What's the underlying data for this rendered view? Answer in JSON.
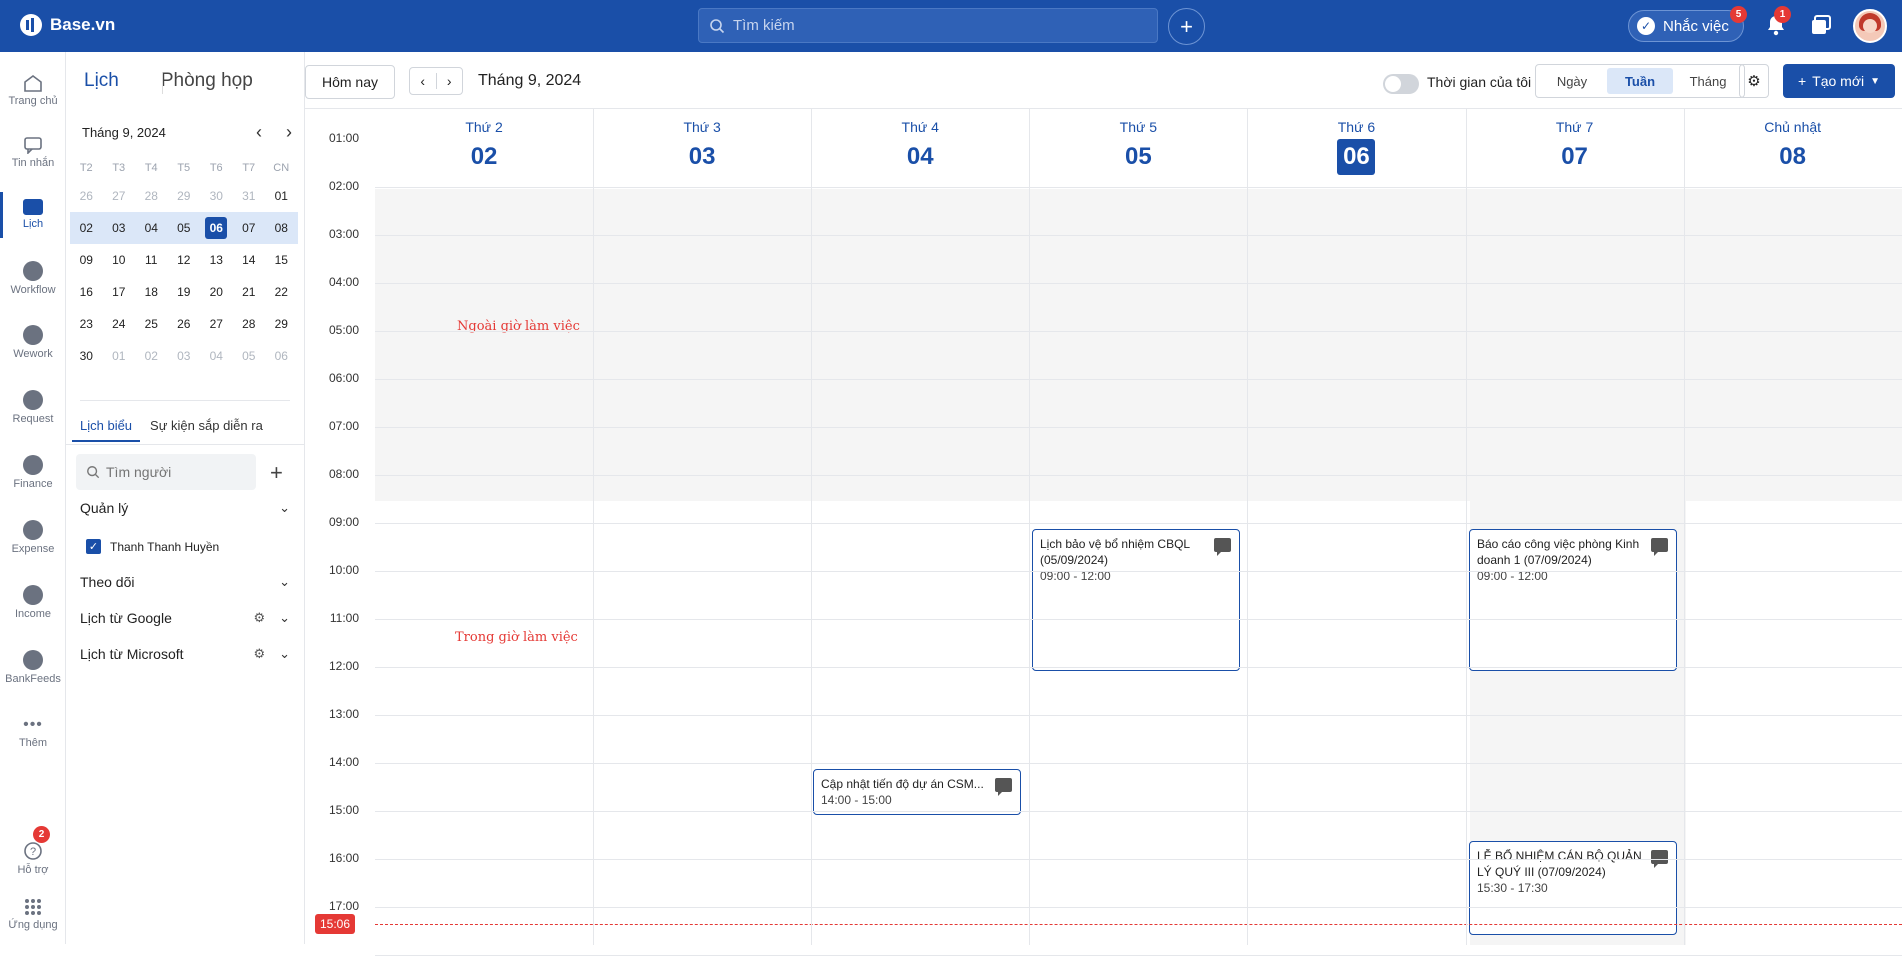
{
  "app": {
    "name": "Base.vn"
  },
  "topbar": {
    "search_placeholder": "Tìm kiếm",
    "remind_label": "Nhắc việc",
    "remind_badge": "5",
    "notif_badge": "1"
  },
  "nav": {
    "items": [
      {
        "label": "Trang chủ"
      },
      {
        "label": "Tin nhắn"
      },
      {
        "label": "Lịch"
      },
      {
        "label": "Workflow"
      },
      {
        "label": "Wework"
      },
      {
        "label": "Request"
      },
      {
        "label": "Finance"
      },
      {
        "label": "Expense"
      },
      {
        "label": "Income"
      },
      {
        "label": "BankFeeds"
      },
      {
        "label": "Thêm"
      }
    ],
    "support_label": "Hỗ trợ",
    "support_badge": "2",
    "apps_label": "Ứng dụng"
  },
  "sidebar": {
    "tab_calendar": "Lịch",
    "tab_rooms": "Phòng họp",
    "mini_title": "Tháng 9, 2024",
    "weekdays": [
      "T2",
      "T3",
      "T4",
      "T5",
      "T6",
      "T7",
      "CN"
    ],
    "weeks": [
      [
        "26",
        "27",
        "28",
        "29",
        "30",
        "31",
        "01"
      ],
      [
        "02",
        "03",
        "04",
        "05",
        "06",
        "07",
        "08"
      ],
      [
        "09",
        "10",
        "11",
        "12",
        "13",
        "14",
        "15"
      ],
      [
        "16",
        "17",
        "18",
        "19",
        "20",
        "21",
        "22"
      ],
      [
        "23",
        "24",
        "25",
        "26",
        "27",
        "28",
        "29"
      ],
      [
        "30",
        "01",
        "02",
        "03",
        "04",
        "05",
        "06"
      ]
    ],
    "subtab_a": "Lịch biểu",
    "subtab_b": "Sự kiện sắp diễn ra",
    "find_placeholder": "Tìm người",
    "group_manage": "Quản lý",
    "member_name": "Thanh Thanh Huyền",
    "group_follow": "Theo dõi",
    "group_google": "Lịch từ Google",
    "group_microsoft": "Lịch từ Microsoft"
  },
  "toolbar": {
    "today": "Hôm nay",
    "month_title": "Tháng 9, 2024",
    "my_time": "Thời gian của tôi",
    "views": [
      "Ngày",
      "Tuần",
      "Tháng"
    ],
    "create": "Tạo mới"
  },
  "week": {
    "days": [
      {
        "dow": "Thứ 2",
        "date": "02"
      },
      {
        "dow": "Thứ 3",
        "date": "03"
      },
      {
        "dow": "Thứ 4",
        "date": "04"
      },
      {
        "dow": "Thứ 5",
        "date": "05"
      },
      {
        "dow": "Thứ 6",
        "date": "06"
      },
      {
        "dow": "Thứ 7",
        "date": "07"
      },
      {
        "dow": "Chủ nhật",
        "date": "08"
      }
    ],
    "hours": [
      "01:00",
      "02:00",
      "03:00",
      "04:00",
      "05:00",
      "06:00",
      "07:00",
      "08:00",
      "09:00",
      "10:00",
      "11:00",
      "12:00",
      "13:00",
      "14:00",
      "15:00",
      "16:00",
      "17:00"
    ],
    "now": "15:06",
    "off_hours_label": "Ngoài giờ làm việc",
    "work_hours_label": "Trong giờ làm việc",
    "events": [
      {
        "title": "Lịch bảo vệ bổ nhiệm CBQL (05/09/2024)",
        "time": "09:00 - 12:00"
      },
      {
        "title": "Báo cáo công việc phòng Kinh doanh 1 (07/09/2024)",
        "time": "09:00 - 12:00"
      },
      {
        "title": "Cập nhật tiến độ dự án CSM...",
        "time": "14:00 - 15:00"
      },
      {
        "title": "LỄ BỔ NHIỆM CÁN BỘ QUẢN LÝ QUÝ III (07/09/2024)",
        "time": "15:30 - 17:30"
      }
    ]
  }
}
